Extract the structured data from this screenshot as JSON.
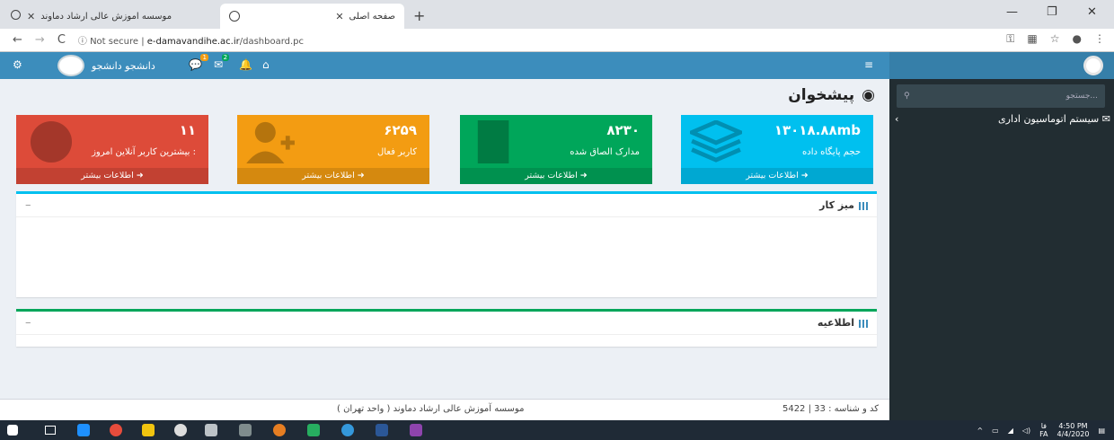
{
  "browser": {
    "tab_inactive_title": "موسسه اموزش عالی ارشاد دماوند",
    "tab_active_title": "صفحه اصلی",
    "url_prefix": "Not secure | ",
    "url_host": "e-damavandihe.ac.ir",
    "url_path": "/dashboard.pc"
  },
  "header": {
    "user_name": "دانشجو دانشجو",
    "msg_badge": "1",
    "mail_badge": "2"
  },
  "sidebar": {
    "search_placeholder": "جستجو...",
    "menu_item": "سیستم اتوماسیون اداری"
  },
  "page": {
    "title": "پیشخوان"
  },
  "stats": [
    {
      "value": "۱۳۰۱۸.۸۸mb",
      "label": "حجم پایگاه داده",
      "more": "اطلاعات بیشتر",
      "color": "#00c0ef"
    },
    {
      "value": "۸۲۳۰",
      "label": "مدارک الصاق شده",
      "more": "اطلاعات بیشتر",
      "color": "#00a65a"
    },
    {
      "value": "۶۲۵۹",
      "label": "کاربر فعال",
      "more": "اطلاعات بیشتر",
      "color": "#f39c12"
    },
    {
      "value": "۱۱",
      "label": "بیشترین کاربر آنلاین امروز :",
      "more": "اطلاعات بیشتر",
      "color": "#dd4b39"
    }
  ],
  "panels": {
    "desk_title": "میز کار",
    "news_title": "اطلاعیه",
    "collapse": "–"
  },
  "footer": {
    "code": "کد و شناسه : 33 | 5422",
    "institute": "موسسه آموزش عالی ارشاد دماوند ( واحد تهران )"
  },
  "taskbar": {
    "lang": "FA",
    "lang_top": "فا",
    "time": "4:50 PM",
    "date": "4/4/2020"
  }
}
